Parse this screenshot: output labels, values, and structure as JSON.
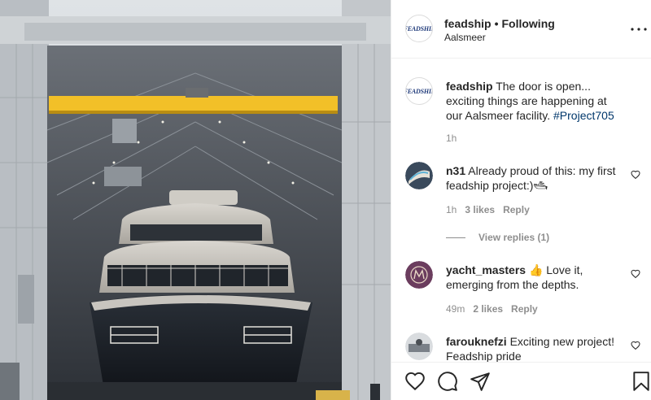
{
  "post": {
    "username": "feadship",
    "separator": "•",
    "follow_label": "Following",
    "location": "Aalsmeer",
    "logo_text": "FEADSHIP",
    "more_icon": "more-options-icon"
  },
  "caption": {
    "username": "feadship",
    "text": " The door is open... exciting things are happening at our Aalsmeer facility. ",
    "hashtag": "#Project705",
    "time": "1h"
  },
  "comments": [
    {
      "username": "n31",
      "text": " Already proud of this: my first feadship project:)",
      "emoji": "🛥",
      "time": "1h",
      "likes": "3 likes",
      "reply_label": "Reply",
      "view_replies": "View replies (1)"
    },
    {
      "username": "yacht_masters",
      "text": " 👍 Love it, emerging from the depths.",
      "time": "49m",
      "likes": "2 likes",
      "reply_label": "Reply"
    },
    {
      "username": "farouknefzi",
      "text": " Exciting new project! Feadship pride"
    }
  ],
  "actions": {
    "like_icon": "heart-icon",
    "comment_icon": "comment-icon",
    "share_icon": "share-icon",
    "save_icon": "bookmark-icon"
  },
  "colors": {
    "text": "#262626",
    "muted": "#8e8e8e",
    "hashtag": "#00376b",
    "crane": "#f2c028"
  }
}
